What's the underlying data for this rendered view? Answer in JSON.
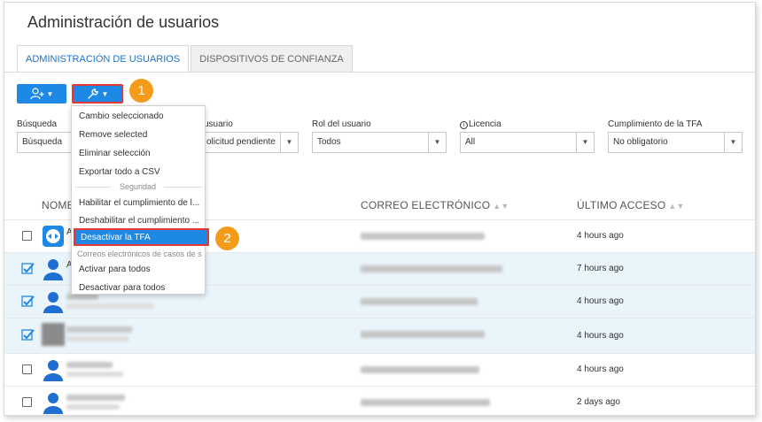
{
  "page": {
    "title": "Administración de usuarios"
  },
  "tabs": [
    {
      "label": "ADMINISTRACIÓN DE USUARIOS",
      "active": true
    },
    {
      "label": "DISPOSITIVOS DE CONFIANZA",
      "active": false
    }
  ],
  "toolbar": {
    "add_user_icon": "add-user-icon",
    "tools_icon": "wrench-icon"
  },
  "callouts": {
    "one": "1",
    "two": "2"
  },
  "filters": {
    "search": {
      "label": "Búsqueda",
      "placeholder": "Búsqueda"
    },
    "status": {
      "label": "usuario",
      "value": "olicitud pendiente"
    },
    "role": {
      "label": "Rol del usuario",
      "value": "Todos"
    },
    "license": {
      "label": "Licencia",
      "value": "All"
    },
    "tfa": {
      "label": "Cumplimiento de la TFA",
      "value": "No obligatorio"
    }
  },
  "table": {
    "columns": {
      "name": "NOMB",
      "email": "CORREO ELECTRÓNICO",
      "last_access": "ÚLTIMO ACCESO"
    },
    "rows": [
      {
        "checked": false,
        "name_initial": "A",
        "last_access": "4 hours ago"
      },
      {
        "checked": true,
        "name_initial": "A",
        "last_access": "7 hours ago"
      },
      {
        "checked": true,
        "name_initial": "",
        "last_access": "4 hours ago"
      },
      {
        "checked": true,
        "name_initial": "",
        "last_access": "4 hours ago"
      },
      {
        "checked": false,
        "name_initial": "",
        "last_access": "4 hours ago"
      },
      {
        "checked": false,
        "name_initial": "",
        "last_access": "2 days ago"
      }
    ]
  },
  "menu": {
    "items": [
      "Cambio seleccionado",
      "Remove selected",
      "Eliminar selección",
      "Exportar todo a CSV"
    ],
    "section_security": "Seguridad",
    "security_items": [
      "Habilitar el cumplimiento de l...",
      "Deshabilitar el cumplimiento ...",
      "Desactivar la TFA"
    ],
    "section_emails": "Correos electrónicos de casos de s",
    "email_items": [
      "Activar para todos",
      "Desactivar para todos"
    ]
  },
  "colors": {
    "accent": "#1e88e5",
    "highlight": "#e53935",
    "callout": "#f59b1c",
    "selected_row": "#eaf4fb"
  }
}
